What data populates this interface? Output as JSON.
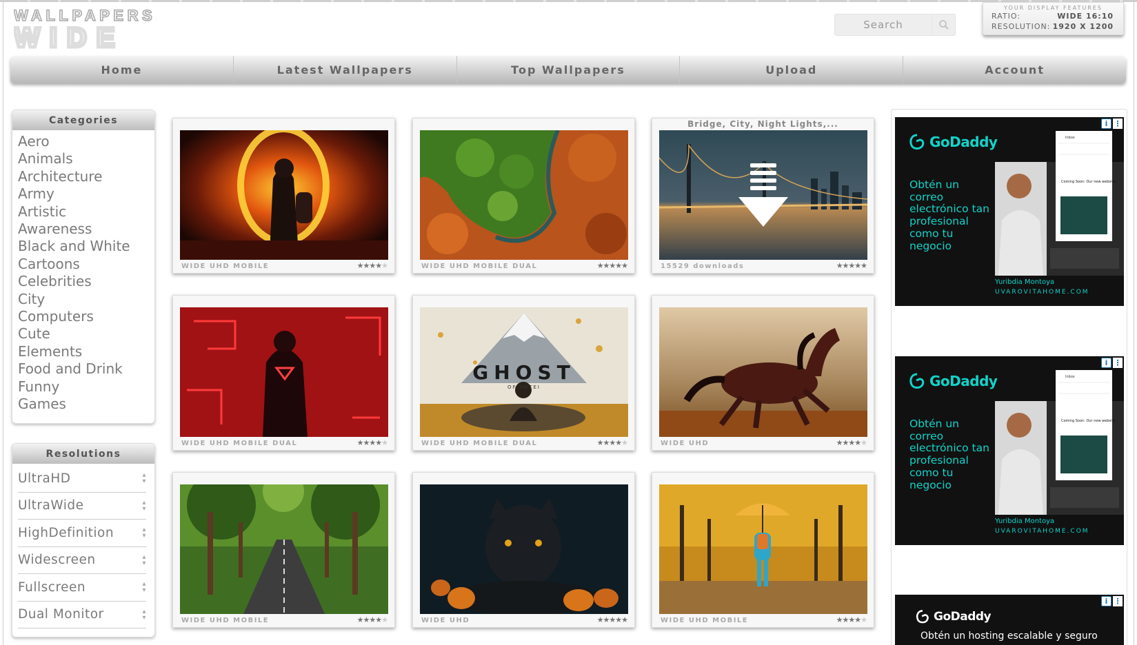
{
  "logo": {
    "line1": "WALLPAPERS",
    "line2": "WIDE"
  },
  "search": {
    "placeholder": "Search"
  },
  "features": {
    "title": "YOUR DISPLAY FEATURES",
    "ratio_label": "RATIO:",
    "ratio_value": "WIDE 16:10",
    "resolution_label": "RESOLUTION:",
    "resolution_value": "1920 X 1200"
  },
  "nav": [
    "Home",
    "Latest Wallpapers",
    "Top Wallpapers",
    "Upload",
    "Account"
  ],
  "categories": {
    "title": "Categories",
    "items": [
      "Aero",
      "Animals",
      "Architecture",
      "Army",
      "Artistic",
      "Awareness",
      "Black and White",
      "Cartoons",
      "Celebrities",
      "City",
      "Computers",
      "Cute",
      "Elements",
      "Food and Drink",
      "Funny",
      "Games"
    ]
  },
  "resolutions": {
    "title": "Resolutions",
    "items": [
      "UltraHD",
      "UltraWide",
      "HighDefinition",
      "Widescreen",
      "Fullscreen",
      "Dual Monitor"
    ]
  },
  "wallpapers": [
    {
      "title": "",
      "tags": "WIDE UHD MOBILE",
      "rating": 4
    },
    {
      "title": "",
      "tags": "WIDE UHD MOBILE DUAL",
      "rating": 5
    },
    {
      "title": "Bridge, City, Night Lights,...",
      "tags": "15529 downloads",
      "rating": 5
    },
    {
      "title": "",
      "tags": "WIDE UHD MOBILE DUAL",
      "rating": 4.5
    },
    {
      "title": "",
      "tags": "WIDE UHD MOBILE DUAL",
      "rating": 4
    },
    {
      "title": "",
      "tags": "WIDE UHD",
      "rating": 4.5
    },
    {
      "title": "",
      "tags": "WIDE UHD MOBILE",
      "rating": 4
    },
    {
      "title": "",
      "tags": "WIDE UHD",
      "rating": 5
    },
    {
      "title": "",
      "tags": "WIDE UHD MOBILE",
      "rating": 4
    }
  ],
  "wallpaper_text": {
    "ghost_title": "GHOST",
    "ghost_sub": "OF YOTEI"
  },
  "ads": {
    "brand": "GoDaddy",
    "tagline": "Obtén un correo electrónico tan profesional como tu negocio",
    "person": "Yuribdia Montoya",
    "site": "UVAROVITAHOME.COM",
    "tagline2": "Obtén un hosting escalable y seguro",
    "info_glyph": "i",
    "close_glyph": "⋮",
    "mock_header": "Inbox",
    "mock_notice": "Coming Soon: Our new website."
  },
  "colors": {
    "brand_teal": "#11d3c9",
    "nav_text": "#666666",
    "link_grey": "#7a7a7a"
  }
}
